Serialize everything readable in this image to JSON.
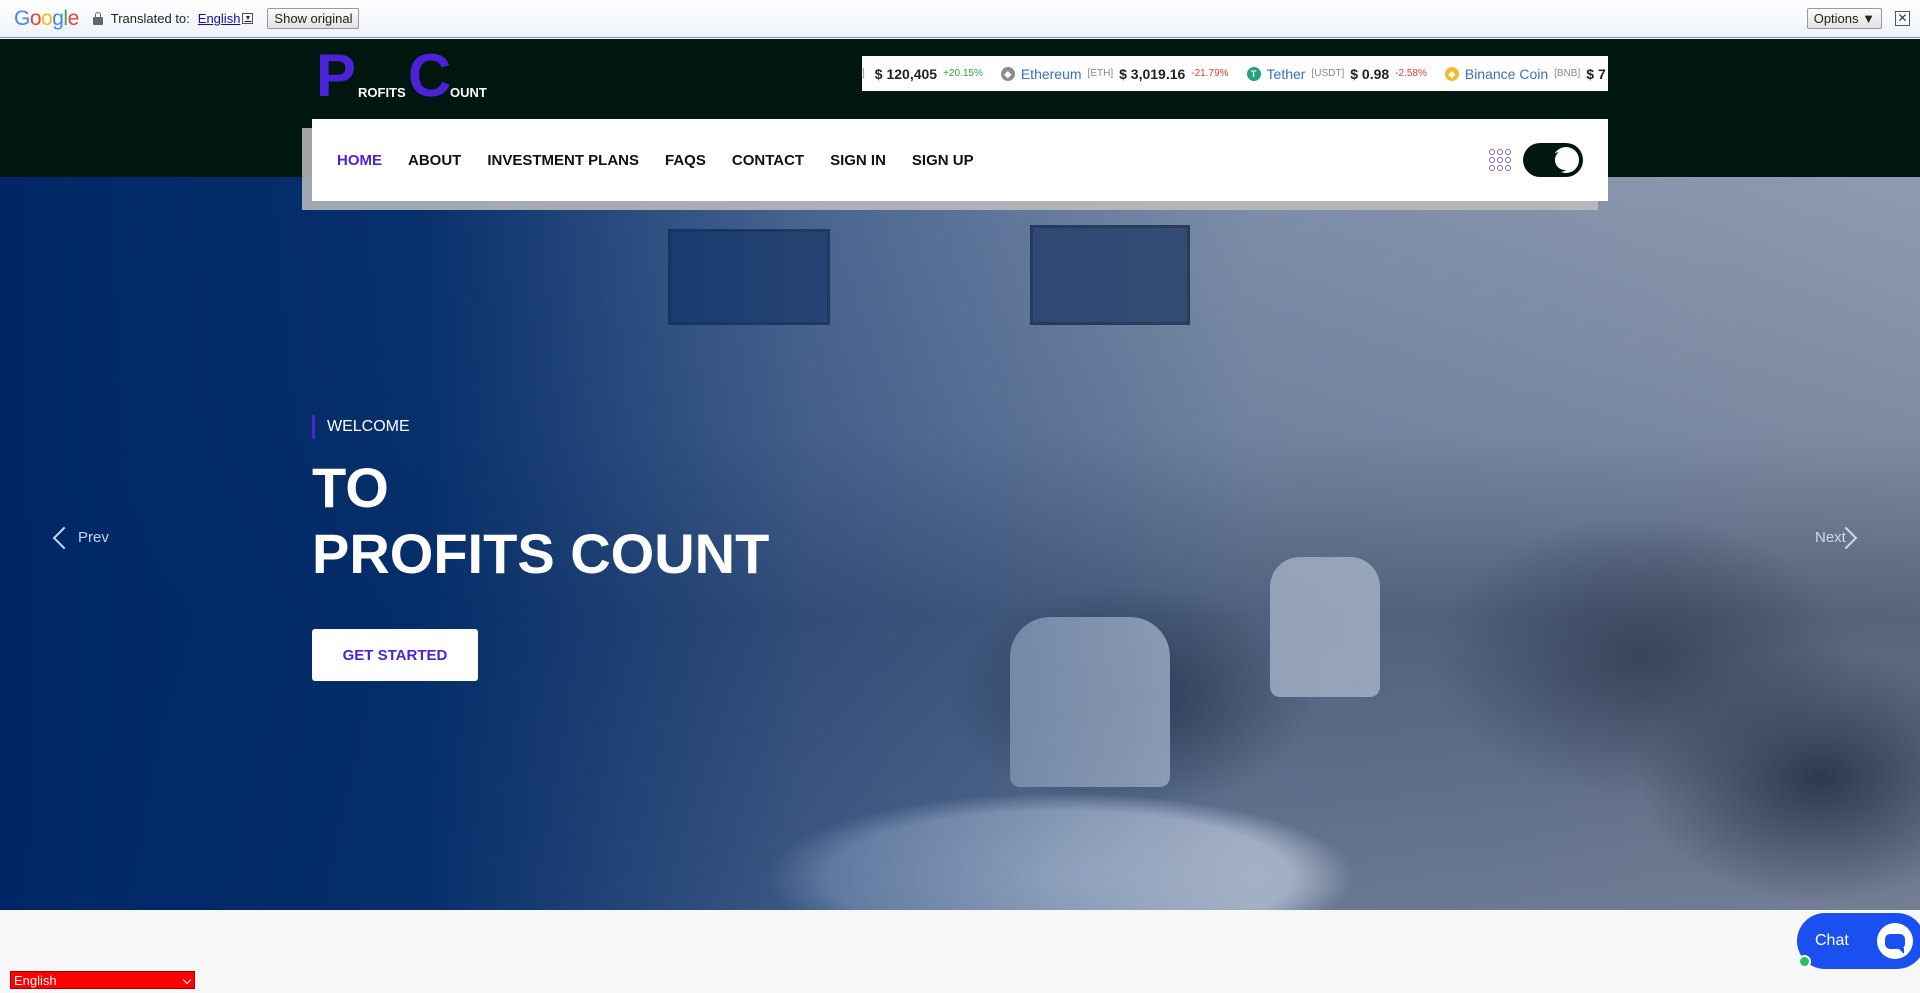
{
  "translate_bar": {
    "logo": "Google",
    "label": "Translated to:",
    "language": "English",
    "show_original": "Show original",
    "options": "Options ▼",
    "close": "✕"
  },
  "logo": {
    "big1": "P",
    "small1": "ROFITS",
    "big2": "C",
    "small2": "OUNT"
  },
  "ticker": [
    {
      "name": "",
      "symbol": "",
      "price": "$ 120,405",
      "change": "+20.15%",
      "trend": "up",
      "icon_color": "#f7931a",
      "icon": "bitcoin-icon",
      "lead": "]"
    },
    {
      "name": "Ethereum",
      "symbol": "[ETH]",
      "price": "$ 3,019.16",
      "change": "-21.79%",
      "trend": "down",
      "icon_color": "#8c8c8c",
      "icon": "ethereum-icon"
    },
    {
      "name": "Tether",
      "symbol": "[USDT]",
      "price": "$ 0.98",
      "change": "-2.58%",
      "trend": "down",
      "icon_color": "#26a17b",
      "icon": "tether-icon"
    },
    {
      "name": "Binance Coin",
      "symbol": "[BNB]",
      "price": "$ 7",
      "change": "",
      "trend": "up",
      "icon_color": "#f3ba2f",
      "icon": "binance-icon"
    }
  ],
  "nav": {
    "items": [
      "HOME",
      "ABOUT",
      "INVESTMENT PLANS",
      "FAQS",
      "CONTACT",
      "SIGN IN",
      "SIGN UP"
    ],
    "active_index": 0,
    "accent": "#4b22d8"
  },
  "hero": {
    "welcome": "WELCOME",
    "title_line1": "TO",
    "title_line2": "PROFITS COUNT",
    "cta": "GET STARTED",
    "prev": "Prev",
    "next": "Next"
  },
  "chat": {
    "label": "Chat"
  },
  "language_select": {
    "value": "English"
  }
}
